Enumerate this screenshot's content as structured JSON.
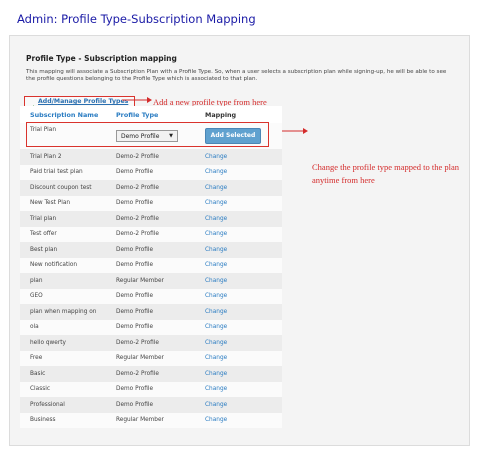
{
  "page_title": "Admin: Profile Type-Subscription Mapping",
  "panel": {
    "heading": "Profile Type - Subscription mapping",
    "description": "This mapping will associate a Subscription Plan with a Profile Type. So, when a user selects a subscription plan while signing-up, he will be able to see the profile questions belonging to the Profile Type which is associated to that plan.",
    "add_link_label": "Add/Manage Profile Types",
    "add_icon": "folder-add-icon"
  },
  "annotations": {
    "add_note": "Add a new profile type from here",
    "change_note_line1": "Change the profile type mapped to the plan",
    "change_note_line2": "anytime from here",
    "color": "#d42b2b"
  },
  "table": {
    "headers": [
      "Subscription Name",
      "Profile Type",
      "Mapping"
    ],
    "editing_row": {
      "name": "Trial Plan",
      "selected_profile": "Demo Profile",
      "button_label": "Add Selected"
    },
    "rows": [
      {
        "name": "Trial Plan 2",
        "profile": "Demo-2 Profile",
        "action": "Change"
      },
      {
        "name": "Paid trial test plan",
        "profile": "Demo Profile",
        "action": "Change"
      },
      {
        "name": "Discount coupon test",
        "profile": "Demo-2 Profile",
        "action": "Change"
      },
      {
        "name": "New Test Plan",
        "profile": "Demo Profile",
        "action": "Change"
      },
      {
        "name": "Trial plan",
        "profile": "Demo-2 Profile",
        "action": "Change"
      },
      {
        "name": "Test offer",
        "profile": "Demo-2 Profile",
        "action": "Change"
      },
      {
        "name": "Best plan",
        "profile": "Demo Profile",
        "action": "Change"
      },
      {
        "name": "New notification",
        "profile": "Demo Profile",
        "action": "Change"
      },
      {
        "name": "plan",
        "profile": "Regular Member",
        "action": "Change"
      },
      {
        "name": "GEO",
        "profile": "Demo Profile",
        "action": "Change"
      },
      {
        "name": "plan when mapping on",
        "profile": "Demo Profile",
        "action": "Change"
      },
      {
        "name": "ola",
        "profile": "Demo Profile",
        "action": "Change"
      },
      {
        "name": "hello qwerty",
        "profile": "Demo-2 Profile",
        "action": "Change"
      },
      {
        "name": "Free",
        "profile": "Regular Member",
        "action": "Change"
      },
      {
        "name": "Basic",
        "profile": "Demo-2 Profile",
        "action": "Change"
      },
      {
        "name": "Classic",
        "profile": "Demo Profile",
        "action": "Change"
      },
      {
        "name": "Professional",
        "profile": "Demo Profile",
        "action": "Change"
      },
      {
        "name": "Business",
        "profile": "Regular Member",
        "action": "Change"
      }
    ]
  }
}
